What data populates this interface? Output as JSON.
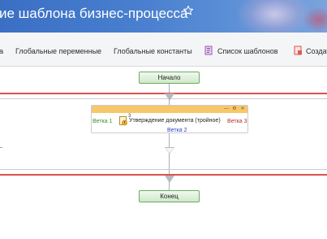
{
  "header": {
    "title": "ие шаблона бизнес-процесса",
    "star_icon": "star-outline-icon",
    "colors": {
      "gradient_start": "#3a6fc4",
      "gradient_end": "#7aa4dd"
    }
  },
  "toolbar": {
    "items": [
      {
        "label": "а"
      },
      {
        "label": "Глобальные переменные"
      },
      {
        "label": "Глобальные константы"
      },
      {
        "label": "Список шаблонов",
        "icon": "template-list-icon"
      },
      {
        "label": "Создат",
        "icon": "create-icon"
      }
    ]
  },
  "workflow": {
    "start_label": "Начало",
    "end_label": "Конец",
    "branch_block": {
      "branch_1": "Ветка 1",
      "branch_2": "Ветка 2",
      "branch_3": "Ветка 3",
      "activity_title": "Утверждение документа (тройное)",
      "activity_count": "3",
      "header_buttons": [
        "minimize",
        "settings",
        "close"
      ]
    },
    "colors": {
      "red_line": "#d9534f",
      "node_border": "#6cab63",
      "branch_header": "#f7c76b"
    }
  }
}
